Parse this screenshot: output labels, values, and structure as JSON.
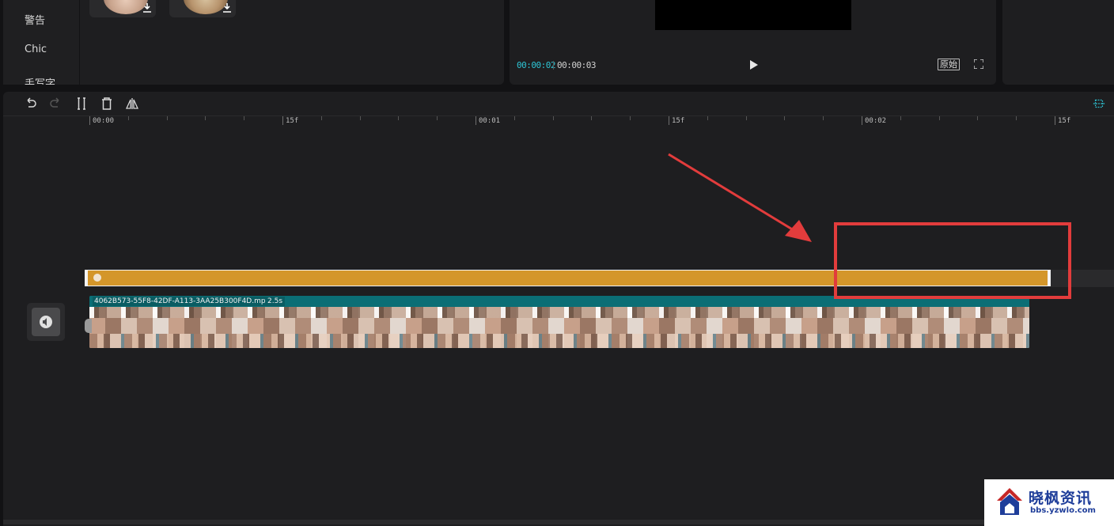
{
  "categories": [
    "警告",
    "Chic",
    "手写字"
  ],
  "preview": {
    "current_time": "00:00:02",
    "total_time": "00:00:03",
    "original_label": "原始"
  },
  "ruler": {
    "labels": [
      "00:00",
      "15f",
      "00:01",
      "15f",
      "00:02",
      "15f"
    ]
  },
  "video_clip": {
    "filename": "4062B573-55F8-42DF-A113-3AA25B300F4D.mp4",
    "duration": "2.5s"
  },
  "watermark": {
    "title": "晓枫资讯",
    "url": "bbs.yzwlo.com"
  },
  "colors": {
    "sticker_track": "#d4962a",
    "video_track": "#006b73",
    "accent_timecode": "#2ec4d4",
    "annotation": "#e23c3c",
    "watermark_text": "#1f3e9a"
  },
  "icons": [
    "download-icon",
    "play-icon",
    "fullscreen-icon",
    "undo-icon",
    "redo-icon",
    "split-icon",
    "delete-icon",
    "mirror-icon",
    "snap-icon",
    "volume-icon"
  ]
}
